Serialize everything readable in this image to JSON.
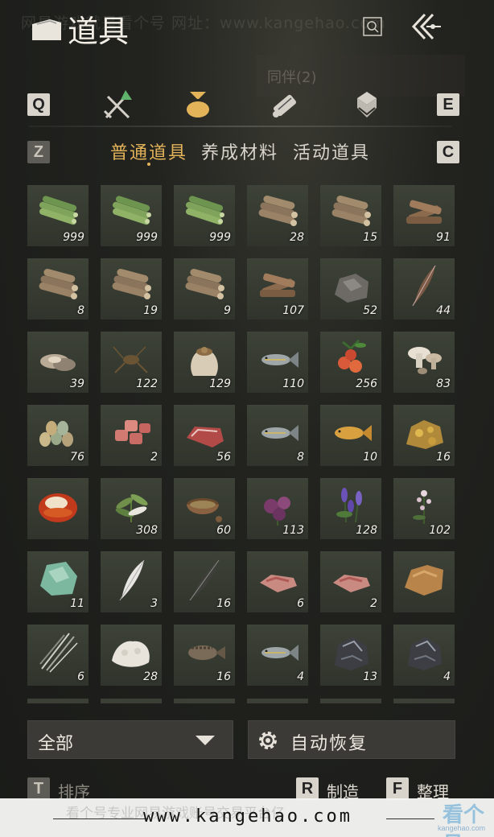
{
  "watermark": {
    "top": "网易游戏就是看个号  网址：www.kangehao.com",
    "footer_faint": "看个号专业网易游戏账号交易平台亿",
    "url": "www.kangehao.com",
    "logo": "看个号",
    "logo_sub": "kangehao.com"
  },
  "header": {
    "title": "道具",
    "icons": [
      "bag-icon",
      "search-icon",
      "back-icon"
    ]
  },
  "companion_banner": {
    "label": "同伴(2)"
  },
  "keys": {
    "prev_tab": "Q",
    "next_tab": "E",
    "prev_sub": "Z",
    "next_sub": "C"
  },
  "category_tabs": [
    {
      "name": "weapons",
      "icon": "crossed-swords-icon",
      "active": false
    },
    {
      "name": "items",
      "icon": "pouch-icon",
      "active": true
    },
    {
      "name": "scrolls",
      "icon": "scroll-icon",
      "active": false
    },
    {
      "name": "gems",
      "icon": "gem-icon",
      "active": false
    }
  ],
  "sub_tabs": [
    {
      "label": "普通道具",
      "active": true
    },
    {
      "label": "养成材料",
      "active": false
    },
    {
      "label": "活动道具",
      "active": false
    }
  ],
  "items": [
    {
      "icon": "bamboo-bundle-icon",
      "qty": "999"
    },
    {
      "icon": "bamboo-bundle-icon",
      "qty": "999"
    },
    {
      "icon": "bamboo-bundle-icon",
      "qty": "999"
    },
    {
      "icon": "log-bundle-icon",
      "qty": "28"
    },
    {
      "icon": "log-bundle-icon",
      "qty": "15"
    },
    {
      "icon": "firewood-icon",
      "qty": "91"
    },
    {
      "icon": "log-bundle-icon",
      "qty": "8"
    },
    {
      "icon": "log-bundle-icon",
      "qty": "19"
    },
    {
      "icon": "log-bundle-icon",
      "qty": "9"
    },
    {
      "icon": "firewood-icon",
      "qty": "107"
    },
    {
      "icon": "ore-stone-icon",
      "qty": "52"
    },
    {
      "icon": "feather-icon",
      "qty": "44"
    },
    {
      "icon": "oyster-icon",
      "qty": "39"
    },
    {
      "icon": "cricket-icon",
      "qty": "122"
    },
    {
      "icon": "grain-sack-icon",
      "qty": "129"
    },
    {
      "icon": "fish-icon",
      "qty": "110"
    },
    {
      "icon": "berries-icon",
      "qty": "256"
    },
    {
      "icon": "mushrooms-icon",
      "qty": "83"
    },
    {
      "icon": "eggs-icon",
      "qty": "76"
    },
    {
      "icon": "meat-cubes-icon",
      "qty": "2"
    },
    {
      "icon": "steak-icon",
      "qty": "56"
    },
    {
      "icon": "fish-icon",
      "qty": "8"
    },
    {
      "icon": "goldfish-icon",
      "qty": "10"
    },
    {
      "icon": "gold-ore-icon",
      "qty": "16"
    },
    {
      "icon": "amber-gem-icon",
      "qty": ""
    },
    {
      "icon": "herb-icon",
      "qty": "308"
    },
    {
      "icon": "spice-bowl-icon",
      "qty": "60"
    },
    {
      "icon": "purple-flower-icon",
      "qty": "113"
    },
    {
      "icon": "lavender-icon",
      "qty": "128"
    },
    {
      "icon": "white-flower-icon",
      "qty": "102"
    },
    {
      "icon": "jade-stone-icon",
      "qty": "11"
    },
    {
      "icon": "white-feather-icon",
      "qty": "3"
    },
    {
      "icon": "dark-feather-icon",
      "qty": "16"
    },
    {
      "icon": "raw-meat-icon",
      "qty": "6"
    },
    {
      "icon": "raw-meat-icon",
      "qty": "2"
    },
    {
      "icon": "fur-pelt-icon",
      "qty": ""
    },
    {
      "icon": "quills-icon",
      "qty": "6"
    },
    {
      "icon": "white-fleece-icon",
      "qty": "28"
    },
    {
      "icon": "rockfish-icon",
      "qty": "16"
    },
    {
      "icon": "fish-icon",
      "qty": "4"
    },
    {
      "icon": "iron-ore-icon",
      "qty": "13"
    },
    {
      "icon": "iron-ore-icon",
      "qty": "4"
    }
  ],
  "filter": {
    "label": "全部",
    "icon": "dropdown-caret-icon"
  },
  "auto_restore": {
    "label": "自动恢复",
    "icon": "gear-icon"
  },
  "bottom_actions": {
    "sort": {
      "key": "T",
      "label": "排序"
    },
    "craft": {
      "key": "R",
      "label": "制造"
    },
    "organize": {
      "key": "F",
      "label": "整理"
    }
  },
  "colors": {
    "accent_gold": "#e3b35a",
    "slot_bg": "#3b4036",
    "background": "#1c1d1a"
  }
}
